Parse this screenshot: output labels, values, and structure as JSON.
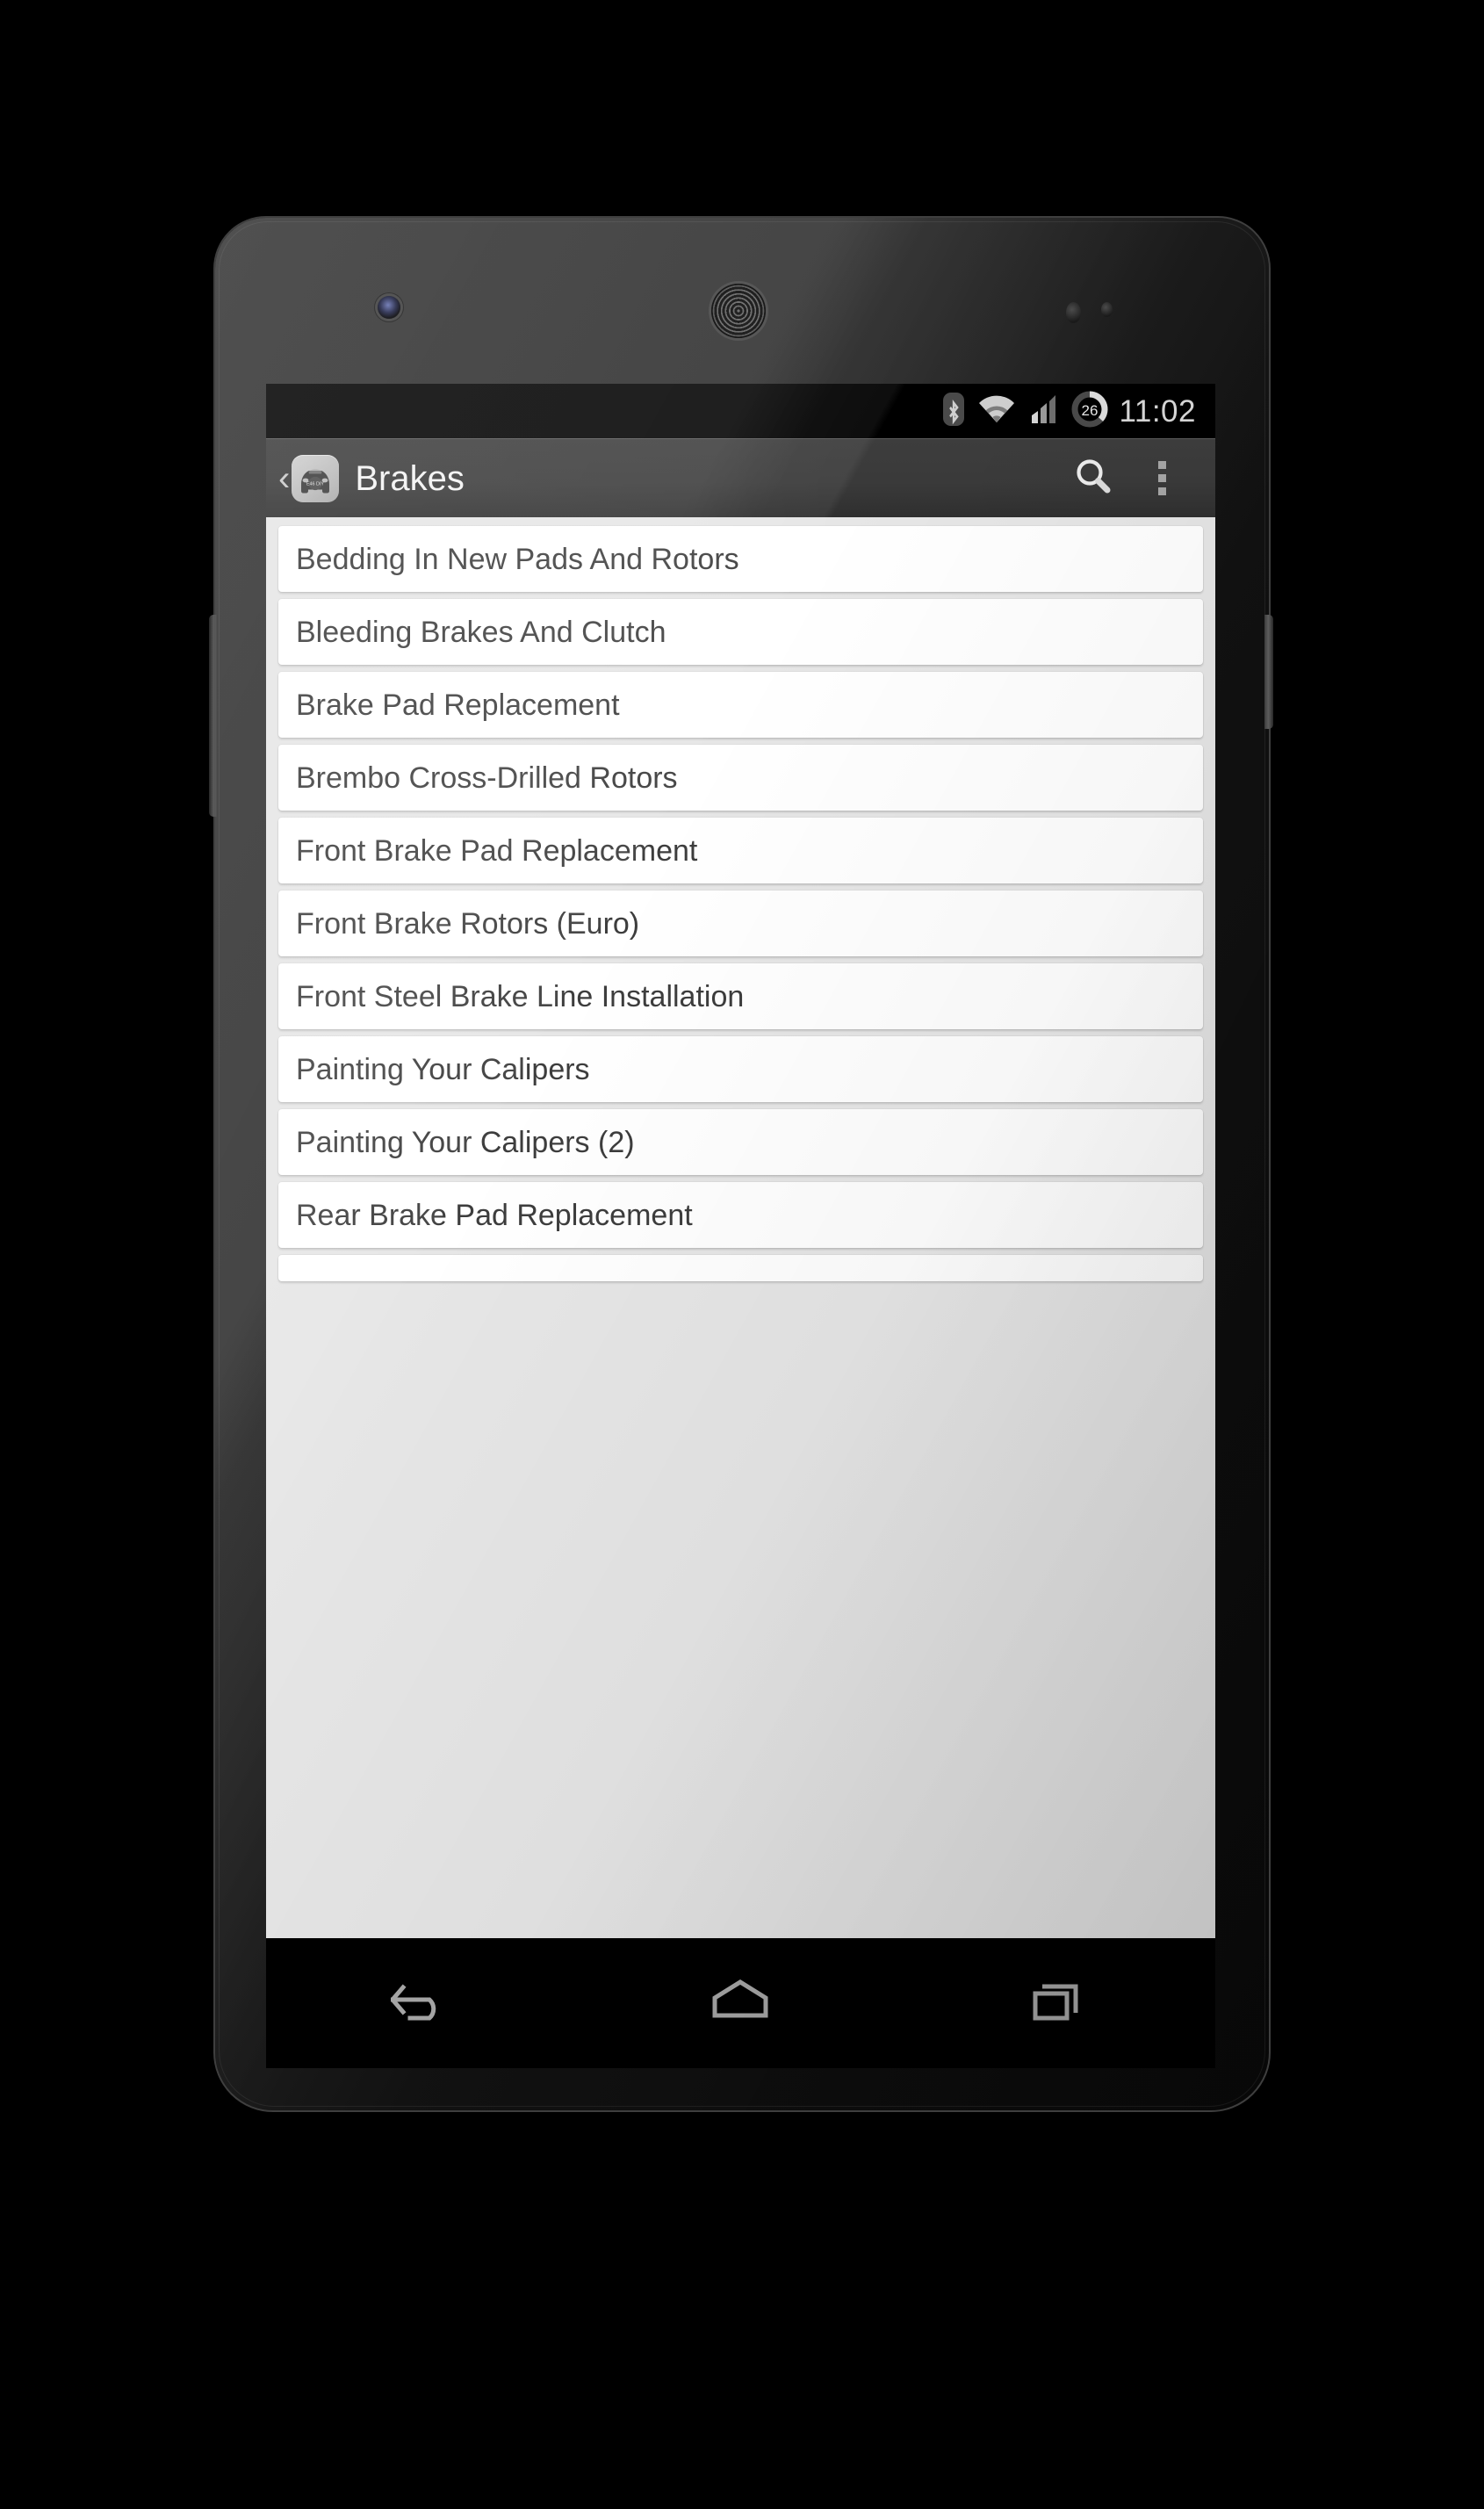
{
  "device": {
    "name": "android-phone-nexus",
    "hardware": {
      "front_camera": "front-camera",
      "earpiece": "earpiece-speaker",
      "power_button": "power-button",
      "volume_button": "volume-rocker"
    }
  },
  "status_bar": {
    "time": "11:02",
    "icons": [
      {
        "name": "bluetooth-icon",
        "label": "Bluetooth"
      },
      {
        "name": "wifi-icon",
        "label": "Wi-Fi"
      },
      {
        "name": "cellular-signal-icon",
        "label": "Signal"
      },
      {
        "name": "battery-circle-icon",
        "label": "26",
        "value": "26"
      }
    ],
    "background_color": "#000000",
    "text_color": "#d8d8d8"
  },
  "action_bar": {
    "back_chevron": "‹",
    "app_icon_name": "app-icon-car",
    "app_icon_plate_text": "E46 DIY",
    "title": "Brakes",
    "search_label": "Search",
    "overflow_label": "More options",
    "background_color": "#3a3a3a",
    "title_color": "#f2f2f2"
  },
  "list": {
    "background_color": "#e6e6e6",
    "card_color": "#ffffff",
    "text_color": "#3d3d3d",
    "items": [
      {
        "label": "Bedding In New Pads And Rotors"
      },
      {
        "label": "Bleeding Brakes And Clutch"
      },
      {
        "label": "Brake Pad Replacement"
      },
      {
        "label": "Brembo Cross-Drilled Rotors"
      },
      {
        "label": "Front Brake Pad Replacement"
      },
      {
        "label": "Front Brake Rotors (Euro)"
      },
      {
        "label": "Front Steel Brake Line Installation"
      },
      {
        "label": "Painting Your Calipers"
      },
      {
        "label": "Painting Your Calipers (2)"
      },
      {
        "label": "Rear Brake Pad Replacement"
      },
      {
        "label": ""
      }
    ]
  },
  "nav_bar": {
    "background_color": "#000000",
    "icon_color": "#a8a8a8",
    "buttons": [
      {
        "name": "back-nav-icon",
        "label": "Back"
      },
      {
        "name": "home-nav-icon",
        "label": "Home"
      },
      {
        "name": "recents-nav-icon",
        "label": "Recent apps"
      }
    ]
  }
}
